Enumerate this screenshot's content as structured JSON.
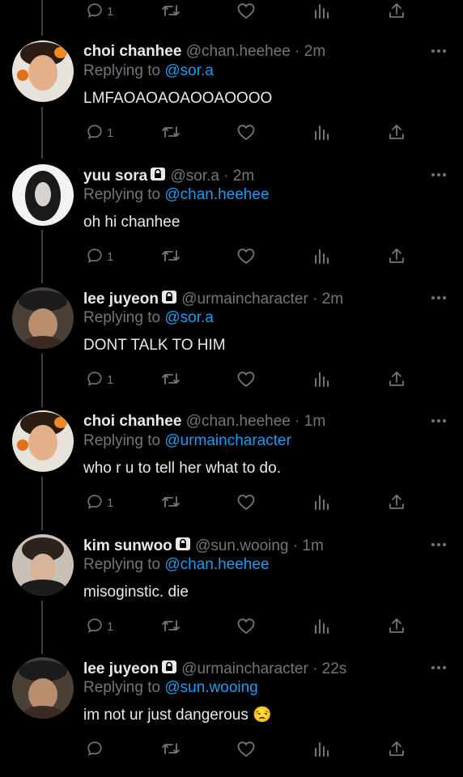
{
  "colors": {
    "background": "#000000",
    "text": "#e7e9ea",
    "muted": "#71767b",
    "mention": "#1d9bf0",
    "thread_line": "#3e4144"
  },
  "icons": {
    "reply": "reply-bubble-icon",
    "retweet": "retweet-icon",
    "like": "heart-icon",
    "views": "views-bar-icon",
    "share": "share-icon",
    "more": "more-dots-icon",
    "lock": "lock-icon"
  },
  "top_actions": {
    "reply_count": "1"
  },
  "tweets": [
    {
      "name": "choi chanhee",
      "locked": false,
      "handle": "@chan.heehee",
      "time": "· 2m",
      "replying_prefix": "Replying to ",
      "replying_to": "@sor.a",
      "text": "LMFAOAOAOAOOAOOOO",
      "reply_count": "1"
    },
    {
      "name": "yuu sora",
      "locked": true,
      "handle": "@sor.a",
      "time": "· 2m",
      "replying_prefix": "Replying to ",
      "replying_to": "@chan.heehee",
      "text": "oh hi chanhee",
      "reply_count": "1"
    },
    {
      "name": "lee juyeon",
      "locked": true,
      "handle": "@urmaincharacter",
      "time": "· 2m",
      "replying_prefix": "Replying to ",
      "replying_to": "@sor.a",
      "text": "DONT TALK TO HIM",
      "reply_count": "1"
    },
    {
      "name": "choi chanhee",
      "locked": false,
      "handle": "@chan.heehee",
      "time": "· 1m",
      "replying_prefix": "Replying to ",
      "replying_to": "@urmaincharacter",
      "text": "who r u to tell her what to do.",
      "reply_count": "1"
    },
    {
      "name": "kim sunwoo",
      "locked": true,
      "handle": "@sun.wooing",
      "time": "· 1m",
      "replying_prefix": "Replying to ",
      "replying_to": "@chan.heehee",
      "text": "misoginstic. die",
      "reply_count": "1"
    },
    {
      "name": "lee juyeon",
      "locked": true,
      "handle": "@urmaincharacter",
      "time": "· 22s",
      "replying_prefix": "Replying to ",
      "replying_to": "@sun.wooing",
      "text": "im not ur just dangerous 😒",
      "reply_count": ""
    }
  ]
}
